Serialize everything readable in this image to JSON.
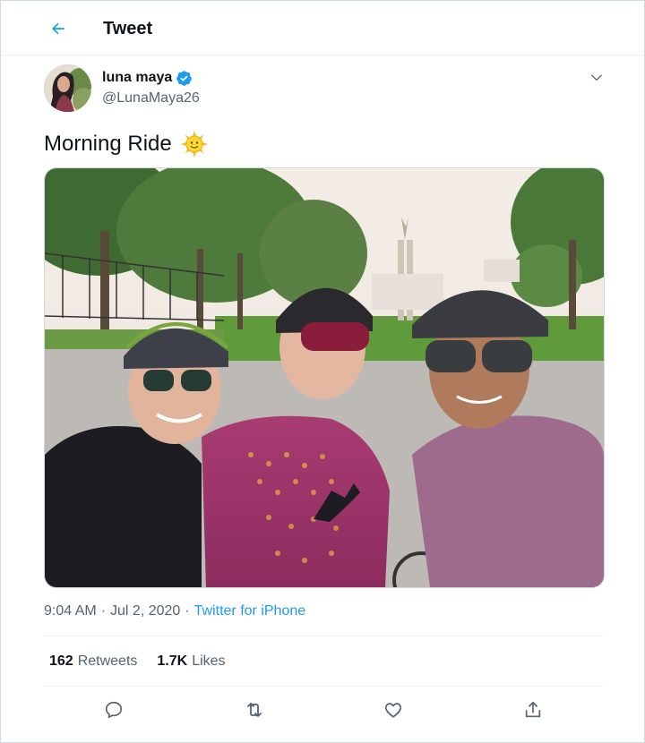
{
  "header": {
    "title": "Tweet",
    "back_icon": "arrow-left-icon"
  },
  "author": {
    "display_name": "luna maya",
    "handle": "@LunaMaya26",
    "verified": true
  },
  "tweet": {
    "text": "Morning Ride",
    "emoji": "sun-with-face-emoji"
  },
  "meta": {
    "time": "9:04 AM",
    "separator": "·",
    "date": "Jul 2, 2020",
    "source": "Twitter for iPhone"
  },
  "stats": {
    "retweets_count": "162",
    "retweets_label": "Retweets",
    "likes_count": "1.7K",
    "likes_label": "Likes"
  },
  "actions": [
    "reply-icon",
    "retweet-icon",
    "like-icon",
    "share-icon"
  ],
  "colors": {
    "accent": "#1d9bf0",
    "text": "#0f1419",
    "secondary": "#536471",
    "border": "#cfd9de"
  }
}
